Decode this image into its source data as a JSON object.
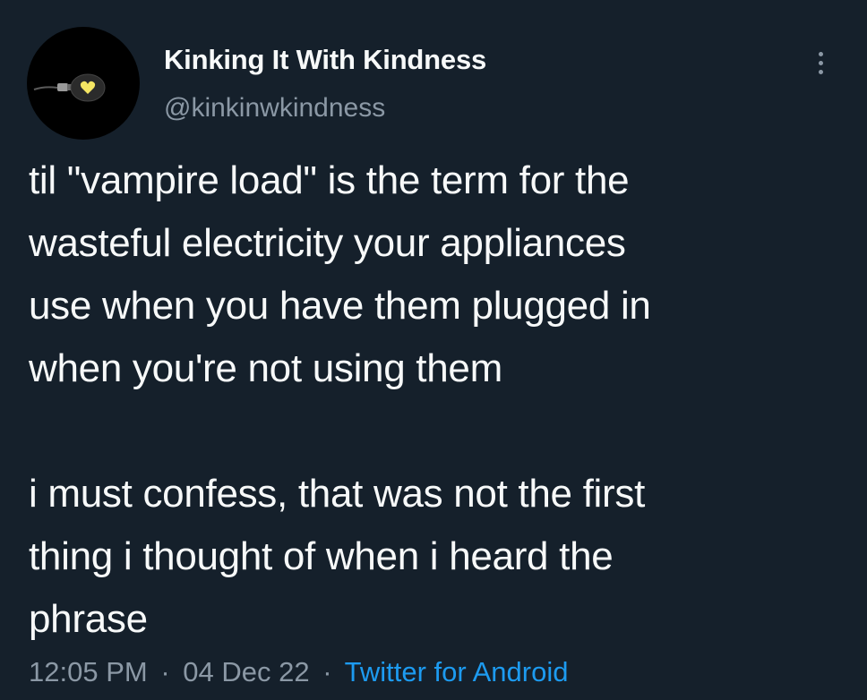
{
  "author": {
    "display_name": "Kinking It With Kindness",
    "handle": "@kinkinwkindness",
    "avatar_icon": "lightbulb-heart-icon"
  },
  "more_icon": "more-vertical-icon",
  "tweet": {
    "paragraph_1": "til \"vampire load\" is the term for the\nwasteful electricity your appliances\nuse when you have them plugged in\nwhen you're not using them",
    "paragraph_2": "i must confess, that was not the first\nthing i thought of when i heard the\nphrase"
  },
  "meta": {
    "time": "12:05 PM",
    "date": "04 Dec 22",
    "separator": "·",
    "source": "Twitter for Android"
  },
  "colors": {
    "background": "#15202b",
    "text": "#f7f9f9",
    "secondary_text": "#8b98a5",
    "link": "#1d9bf0",
    "avatar_bg": "#000000",
    "heart": "#f5e663"
  }
}
